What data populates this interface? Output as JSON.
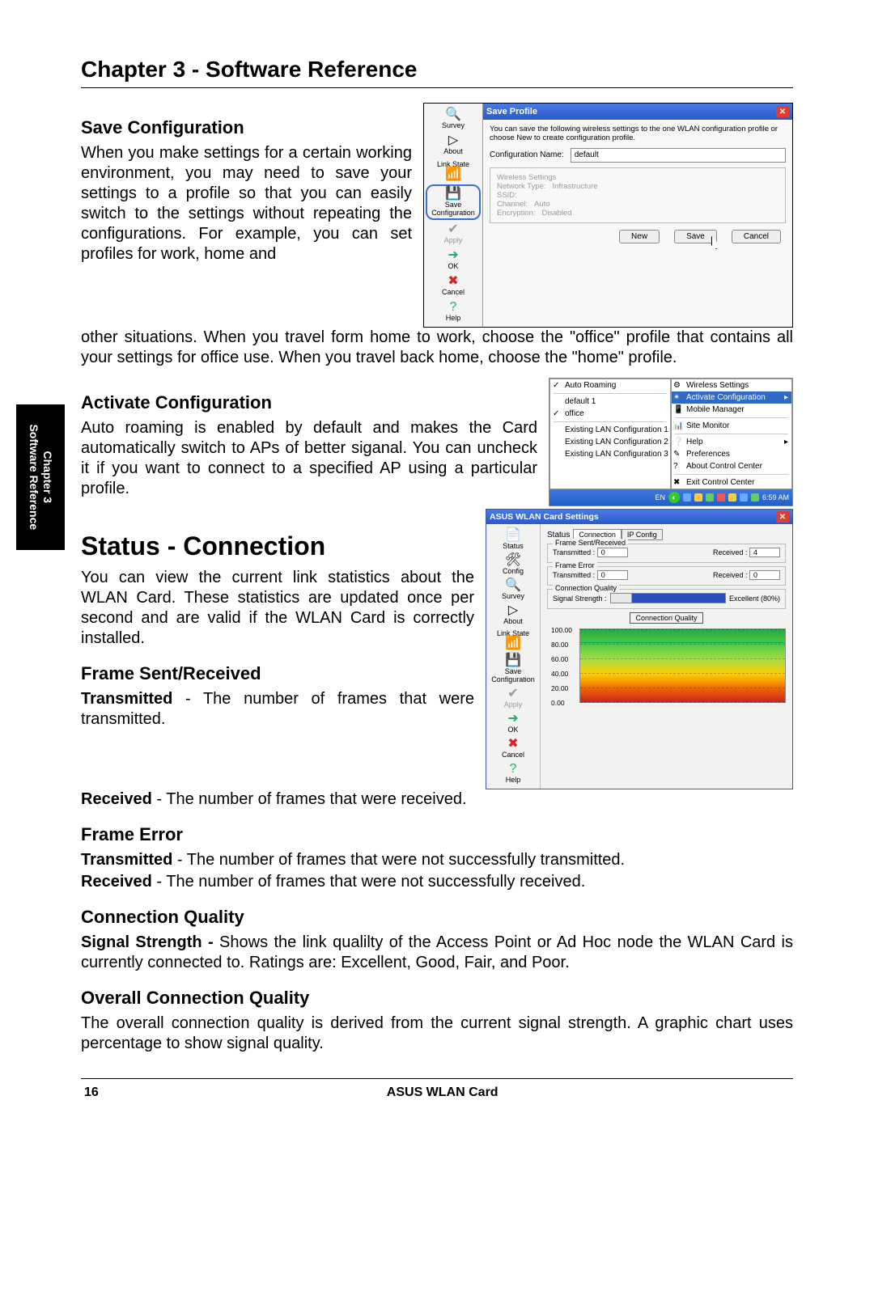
{
  "chapter_title": "Chapter 3 - Software Reference",
  "side_tab_line1": "Chapter 3",
  "side_tab_line2": "Software Reference",
  "sections": {
    "save_cfg": {
      "heading": "Save Configuration",
      "para1": "When you make settings for a certain working environment, you may need to save your settings to a profile so that you can easily switch to the settings without repeating the configurations. For example, you can set profiles for work, home and",
      "para2": "other situations. When you travel form home to work, choose the \"office\" profile that contains all your settings for office use. When you travel back home, choose the \"home\" profile."
    },
    "activate": {
      "heading": "Activate Configuration",
      "para": "Auto roaming is enabled by default and makes the Card automatically switch to APs of better siganal. You can uncheck it if you want to connect to a specified AP using a particular profile."
    },
    "status_conn": {
      "heading": "Status - Connection",
      "para": "You can view the current link statistics about the WLAN Card. These statistics are updated once per second and are valid if the WLAN Card is correctly installed."
    },
    "frame_sr": {
      "heading": "Frame Sent/Received",
      "t_label": "Transmitted",
      "t_text": " - The number of frames that were transmitted.",
      "r_label": "Received",
      "r_text": " - The number of frames that were received."
    },
    "frame_err": {
      "heading": "Frame Error",
      "t_label": "Transmitted",
      "t_text": " - The number of frames that were not successfully transmitted.",
      "r_label": "Received",
      "r_text": " - The number of frames that were not successfully received."
    },
    "cq": {
      "heading": "Connection Quality",
      "label": "Signal Strength -",
      "text": " Shows the link qualilty of the Access Point or Ad Hoc node the WLAN Card is currently connected to. Ratings are: Excellent, Good, Fair, and Poor."
    },
    "ocq": {
      "heading": "Overall Connection Quality",
      "text": "The overall connection quality is derived from the current signal strength. A graphic chart uses percentage to show signal quality."
    }
  },
  "footer": {
    "page": "16",
    "product": "ASUS WLAN Card"
  },
  "iconcol_labels": {
    "survey": "Survey",
    "about": "About",
    "linkstate": "Link State",
    "savecfg": "Save Configuration",
    "apply": "Apply",
    "ok": "OK",
    "cancel": "Cancel",
    "help": "Help",
    "status": "Status",
    "config": "Config"
  },
  "fig1": {
    "title": "Save Profile",
    "hint": "You can save the following wireless settings to the one WLAN configuration profile or choose New to create configuration profile.",
    "cfg_name_label": "Configuration Name:",
    "cfg_name_value": "default",
    "group_title": "Wireless Settings",
    "net_type_label": "Network Type:",
    "net_type_value": "Infrastructure",
    "ssid_label": "SSID:",
    "channel_label": "Channel:",
    "channel_value": "Auto",
    "enc_label": "Encryption:",
    "enc_value": "Disabled",
    "btn_new": "New",
    "btn_save": "Save",
    "btn_cancel": "Cancel"
  },
  "fig2": {
    "left": {
      "auto_roaming": "Auto Roaming",
      "items": [
        "default 1",
        "office"
      ],
      "checked": "office",
      "lan_items": [
        "Existing LAN Configuration 1",
        "Existing LAN Configuration 2",
        "Existing LAN Configuration 3"
      ]
    },
    "right": {
      "title": "Wireless Settings",
      "activate": "Activate Configuration",
      "mobile": "Mobile Manager",
      "site": "Site Monitor",
      "help": "Help",
      "prefs": "Preferences",
      "about": "About Control Center",
      "exit": "Exit Control Center"
    },
    "taskbar": {
      "lang": "EN",
      "time": "6:59 AM"
    }
  },
  "fig3": {
    "title": "ASUS WLAN Card Settings",
    "tabs": {
      "label": "Status",
      "t1": "Connection",
      "t2": "IP Config"
    },
    "g1": {
      "title": "Frame Sent/Received",
      "tx_label": "Transmitted :",
      "tx_val": "0",
      "rx_label": "Received :",
      "rx_val": "4"
    },
    "g2": {
      "title": "Frame Error",
      "tx_label": "Transmitted :",
      "tx_val": "0",
      "rx_label": "Received :",
      "rx_val": "0"
    },
    "g3": {
      "title": "Connection Quality",
      "ss_label": "Signal Strength :",
      "ss_val": "Excellent (80%)"
    },
    "chart_title": "Connection Quality"
  },
  "chart_data": {
    "type": "line",
    "title": "Connection Quality",
    "ylabel": "",
    "xlabel": "",
    "ylim": [
      0,
      100
    ],
    "y_ticks": [
      "0.00",
      "20.00",
      "40.00",
      "60.00",
      "80.00",
      "100.00"
    ],
    "series": [
      {
        "name": "Connection Quality",
        "values": [
          80,
          80,
          82,
          80,
          80,
          82,
          80,
          82,
          82,
          80
        ]
      }
    ]
  }
}
